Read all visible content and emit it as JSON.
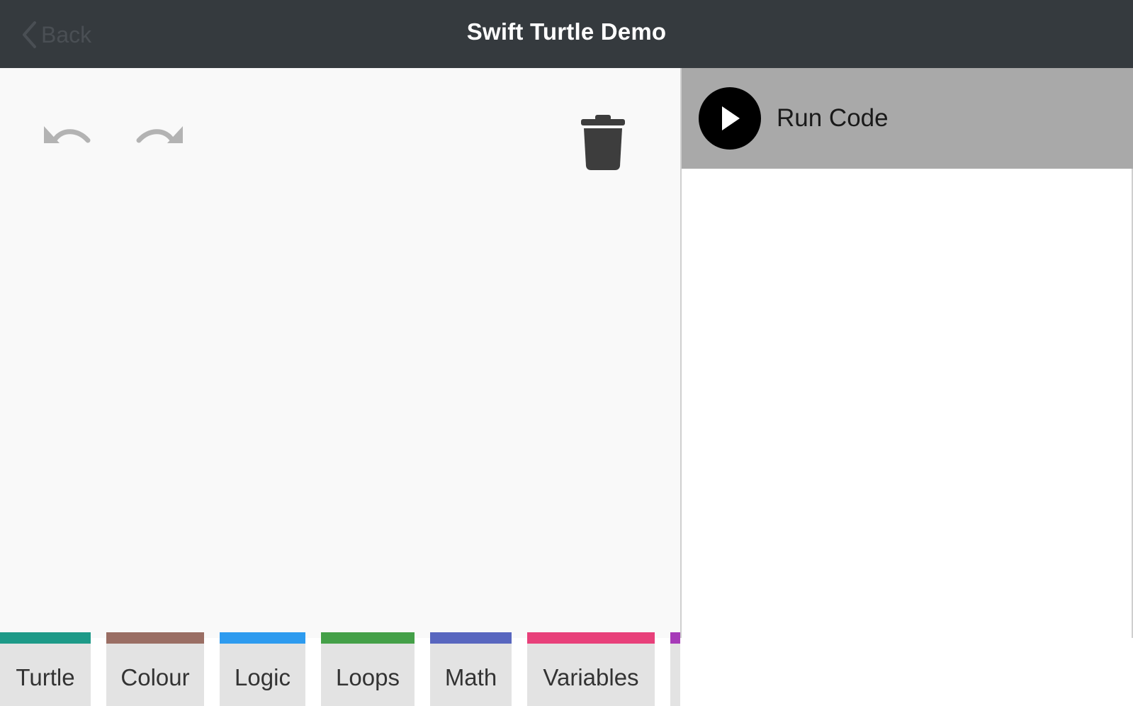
{
  "navbar": {
    "back_label": "Back",
    "title": "Swift Turtle Demo"
  },
  "workspace": {
    "icons": [
      "undo-icon",
      "redo-icon",
      "trash-icon"
    ]
  },
  "toolbox": {
    "categories": [
      {
        "label": "Turtle",
        "color": "#1d9a88"
      },
      {
        "label": "Colour",
        "color": "#9a6e64"
      },
      {
        "label": "Logic",
        "color": "#2d9bef"
      },
      {
        "label": "Loops",
        "color": "#44a048"
      },
      {
        "label": "Math",
        "color": "#5866bf"
      },
      {
        "label": "Variables",
        "color": "#e8407a"
      },
      {
        "label": "",
        "color": "#a63ab8"
      }
    ]
  },
  "output": {
    "run_label": "Run Code"
  }
}
